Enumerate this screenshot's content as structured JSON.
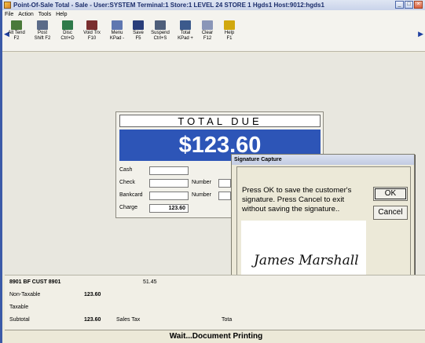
{
  "window": {
    "title": "Point-Of-Sale Total - Sale - User:SYSTEM Terminal:1 Store:1 LEVEL 24 STORE 1 Hgds1 Host:9012:hgds1"
  },
  "menu": [
    "File",
    "Action",
    "Tools",
    "Help"
  ],
  "toolbar": [
    {
      "l1": "Alt Tend",
      "l2": "F2",
      "icon": "alt-tend-icon",
      "color": "#4a7a3a"
    },
    {
      "l1": "Post",
      "l2": "Shift F2",
      "icon": "post-icon",
      "color": "#5b6b88"
    },
    {
      "l1": "Disc",
      "l2": "Ctrl+D",
      "icon": "discount-icon",
      "color": "#2f7a4a"
    },
    {
      "l1": "Void Trx",
      "l2": "F10",
      "icon": "void-icon",
      "color": "#7a2f2f"
    },
    {
      "l1": "Menu",
      "l2": "KPad -",
      "icon": "menu-icon",
      "color": "#5f77b0"
    },
    {
      "l1": "Save",
      "l2": "F5",
      "icon": "save-icon",
      "color": "#2a3e7a"
    },
    {
      "l1": "Suspend",
      "l2": "Ctrl+S",
      "icon": "suspend-icon",
      "color": "#4e5e7a"
    },
    {
      "l1": "Total",
      "l2": "KPad +",
      "icon": "total-icon",
      "color": "#3c5a8c"
    },
    {
      "l1": "Clear",
      "l2": "F12",
      "icon": "clear-icon",
      "color": "#8a96b8"
    },
    {
      "l1": "Help",
      "l2": "F1",
      "icon": "help-icon",
      "color": "#d1a80e"
    }
  ],
  "total": {
    "label": "TOTAL DUE",
    "amount": "$123.60"
  },
  "payments": {
    "cash": "Cash",
    "check": "Check",
    "bankcard": "Bankcard",
    "charge": "Charge",
    "charge_value": "123.60",
    "number1": "Number",
    "number2": "Number"
  },
  "signature_dialog": {
    "title": "Signature Capture",
    "message": "Press OK to save the customer's signature.  Press Cancel to exit without saving the signature..",
    "ok": "OK",
    "cancel": "Cancel",
    "signature": "James Marshall"
  },
  "summary": {
    "customer": "8901 BF CUST 8901",
    "customer_value": "51.45",
    "non_taxable_label": "Non-Taxable",
    "non_taxable_value": "123.60",
    "taxable_label": "Taxable",
    "subtotal_label": "Subtotal",
    "subtotal_value": "123.60",
    "sales_tax_label": "Sales Tax",
    "total_partial": "Tota"
  },
  "status": "Wait...Document Printing"
}
